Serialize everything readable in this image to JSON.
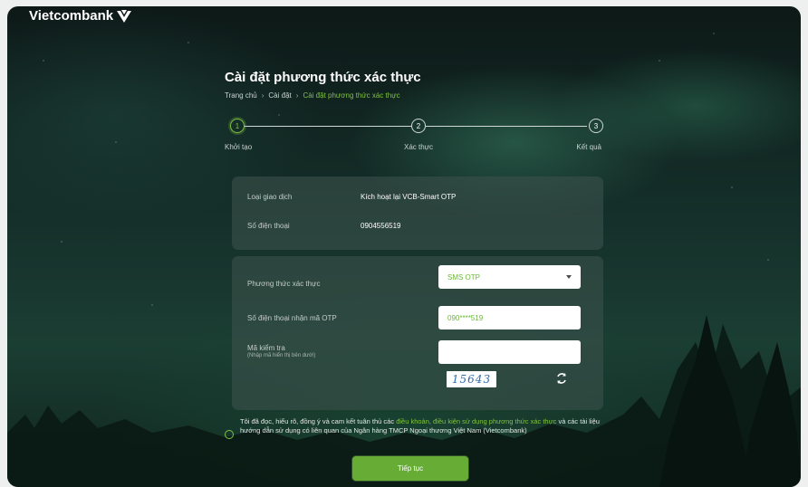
{
  "brand": {
    "name": "Vietcombank"
  },
  "page": {
    "title": "Cài đặt phương thức xác thực"
  },
  "breadcrumb": [
    "Trang chủ",
    "Cài đặt",
    "Cài đặt phương thức xác thực"
  ],
  "stepper": [
    {
      "number": "1",
      "label": "Khởi tạo",
      "active": true
    },
    {
      "number": "2",
      "label": "Xác thực",
      "active": false
    },
    {
      "number": "3",
      "label": "Kết quả",
      "active": false
    }
  ],
  "summary": {
    "transaction_type_label": "Loại giao dịch",
    "transaction_type_value": "Kích hoạt lại VCB-Smart OTP",
    "phone_label": "Số điện thoại",
    "phone_value": "0904556519"
  },
  "form": {
    "method_label": "Phương thức xác thực",
    "method_value": "SMS OTP",
    "otp_phone_label": "Số điện thoại nhận mã OTP",
    "otp_phone_value": "090****519",
    "captcha_label": "Mã kiểm tra",
    "captcha_hint": "(Nhập mã hiển thị bên dưới)",
    "captcha_input_value": "",
    "captcha_code": "15643"
  },
  "agreement": {
    "text_before": "Tôi đã đọc, hiểu rõ, đồng ý và cam kết tuân thủ các ",
    "link": "điều khoản, điều kiện sử dụng phương thức xác thực",
    "text_after": " và các tài liệu hướng dẫn sử dụng có liên quan của Ngân hàng TMCP Ngoại thương Việt Nam (Vietcombank)"
  },
  "actions": {
    "continue_label": "Tiếp tục"
  },
  "colors": {
    "accent": "#7fc241",
    "button": "#67ad35"
  }
}
